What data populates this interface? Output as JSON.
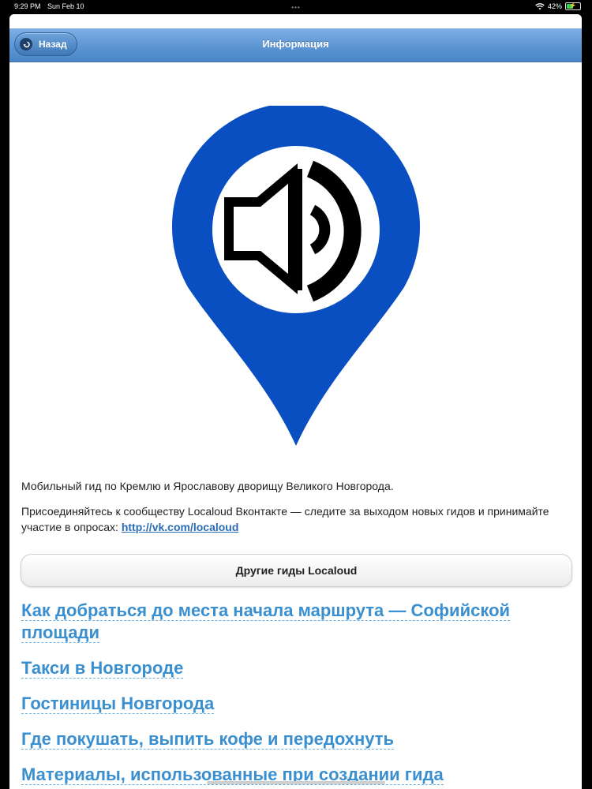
{
  "status": {
    "time": "9:29 PM",
    "date": "Sun Feb 10",
    "battery": "42%",
    "dots": "•••"
  },
  "navbar": {
    "back_label": "Назад",
    "title": "Информация"
  },
  "main": {
    "description": "Мобильный гид по Кремлю и Ярославову дворищу Великого Новгорода.",
    "join_text": "Присоединяйтесь к сообществу Localoud Вконтакте — следите за выходом новых гидов и принимайте участие в опросах:",
    "join_link": "http://vk.com/localoud",
    "other_guides_button": "Другие гиды Localoud"
  },
  "links": [
    "Как добраться до места начала маршрута — Софийской площади",
    "Такси в Новгороде",
    "Гостиницы Новгорода",
    "Где покушать, выпить кофе и передохнуть",
    "Материалы, использованные при создании гида"
  ],
  "colors": {
    "pin_blue": "#0a4fc2",
    "link_blue": "#3a8fd0",
    "navbar_blue": "#5b95d3"
  }
}
